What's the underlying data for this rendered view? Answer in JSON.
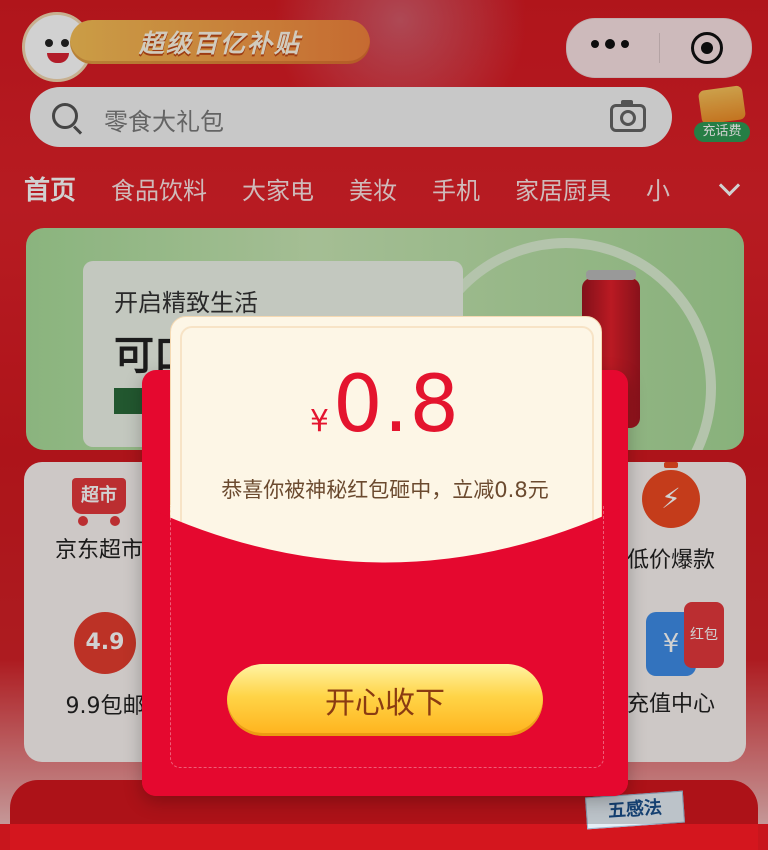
{
  "header": {
    "banner_text": "超级百亿补贴",
    "capsule_menu_icon": "more-dots-icon",
    "capsule_close_icon": "target-close-icon"
  },
  "search": {
    "placeholder": "零食大礼包",
    "camera_icon": "camera-icon",
    "recharge_label": "充话费"
  },
  "tabs": [
    {
      "label": "首页",
      "active": true
    },
    {
      "label": "食品饮料"
    },
    {
      "label": "大家电"
    },
    {
      "label": "美妆"
    },
    {
      "label": "手机"
    },
    {
      "label": "家居厨具"
    },
    {
      "label": "小"
    }
  ],
  "promo": {
    "line1": "开启精致生活",
    "line2": "可口"
  },
  "grid": {
    "items": [
      {
        "label": "京东超市",
        "icon_text": "超市"
      },
      {
        "label": "低价爆款",
        "icon_text": "⚡"
      },
      {
        "label": "9.9包邮",
        "icon_text": "4.9"
      },
      {
        "label": "充值中心",
        "icon_text": "¥",
        "tag": "红包"
      }
    ]
  },
  "bottom": {
    "book_badge": "五感法"
  },
  "modal": {
    "currency": "¥",
    "amount": "0.8",
    "message": "恭喜你被神秘红包砸中，立减0.8元",
    "accept_label": "开心收下"
  },
  "colors": {
    "brand_red": "#d71a22",
    "envelope_red": "#e5082f",
    "amount_red": "#e4142e",
    "button_gold": "#ffc52c"
  }
}
